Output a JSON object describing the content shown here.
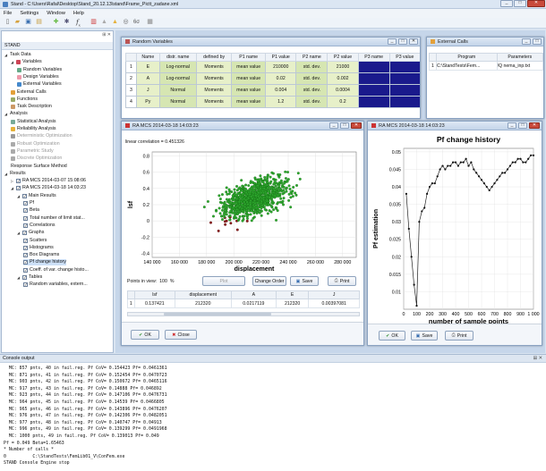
{
  "titlebar": {
    "title": "Stand - C:\\Users\\Rafal\\Desktop\\Stand_20.12.13\\stand\\Frame_Pictt_zadane.xml"
  },
  "menu": [
    "File",
    "Settings",
    "Window",
    "Help"
  ],
  "toolbar_icons": [
    "new-icon",
    "open-icon",
    "save-icon",
    "folder-icon",
    "random-variable-icon",
    "settings-icon",
    "function-icon",
    "chart-icon",
    "sensitivity-icon",
    "reliability-icon",
    "sigma-icon",
    "stop-icon"
  ],
  "tree": {
    "header": "STAND",
    "items": [
      {
        "label": "Task Data",
        "level": 0,
        "expand": "▲"
      },
      {
        "label": "Variables",
        "level": 1,
        "expand": "▲",
        "icon": "#c45"
      },
      {
        "label": "Random Variables",
        "level": 2,
        "icon": "#6a8"
      },
      {
        "label": "Design Variables",
        "level": 2,
        "icon": "#e9a"
      },
      {
        "label": "External Variables",
        "level": 2,
        "icon": "#48c"
      },
      {
        "label": "External Calls",
        "level": 1,
        "icon": "#e3a03a"
      },
      {
        "label": "Functions",
        "level": 1,
        "icon": "#9a6"
      },
      {
        "label": "Task Description",
        "level": 1,
        "icon": "#c96"
      },
      {
        "label": "Analysis",
        "level": 0,
        "expand": "▲"
      },
      {
        "label": "Statistical Analysis",
        "level": 1,
        "icon": "#7a9"
      },
      {
        "label": "Reliability Analysis",
        "level": 1,
        "icon": "#e6b13a"
      },
      {
        "label": "Deterministic Optimization",
        "level": 1,
        "icon": "#999",
        "grey": true
      },
      {
        "label": "Robust Optimization",
        "level": 1,
        "icon": "#aaa",
        "grey": true
      },
      {
        "label": "Parametric Study",
        "level": 1,
        "icon": "#aaa",
        "grey": true
      },
      {
        "label": "Discrete Optimization",
        "level": 1,
        "icon": "#aaa",
        "grey": true
      },
      {
        "label": "Response Surface Method",
        "level": 1
      },
      {
        "label": "Results",
        "level": 0,
        "expand": "▲"
      },
      {
        "label": "RA MCS 2014-03-07 15:08:06",
        "level": 1,
        "expand": "▷",
        "check": true
      },
      {
        "label": "RA MCS 2014-03-18 14:03:23",
        "level": 1,
        "expand": "▲",
        "check": true
      },
      {
        "label": "Main Results",
        "level": 2,
        "expand": "▲",
        "check": true
      },
      {
        "label": "Pf",
        "level": 3,
        "check": true
      },
      {
        "label": "Beta",
        "level": 3,
        "check": true
      },
      {
        "label": "Total number of limit stat...",
        "level": 3,
        "check": true
      },
      {
        "label": "Correlations",
        "level": 3,
        "check": true
      },
      {
        "label": "Graphs",
        "level": 2,
        "expand": "▲",
        "check": true
      },
      {
        "label": "Scatters",
        "level": 3,
        "check": true
      },
      {
        "label": "Histograms",
        "level": 3,
        "check": true
      },
      {
        "label": "Box Diagrams",
        "level": 3,
        "check": true
      },
      {
        "label": "Pf change history",
        "level": 3,
        "check": true,
        "selected": true
      },
      {
        "label": "Coeff. of var. change histo...",
        "level": 3,
        "check": true
      },
      {
        "label": "Tables",
        "level": 2,
        "expand": "▲",
        "check": true
      },
      {
        "label": "Random variables, extern...",
        "level": 3,
        "check": true
      }
    ]
  },
  "rv_window": {
    "title": "Random Variables",
    "headers": [
      "Name",
      "distr. name",
      "defined by",
      "P1 name",
      "P1 value",
      "P2 name",
      "P2 value",
      "P3 name",
      "P3 value"
    ],
    "rows": [
      [
        "1",
        "E",
        "Log-normal",
        "Moments",
        "mean value",
        "210000",
        "std. dev.",
        "21000"
      ],
      [
        "2",
        "A",
        "Log-normal",
        "Moments",
        "mean value",
        "0.02",
        "std. dev.",
        "0.002"
      ],
      [
        "3",
        "J",
        "Normal",
        "Moments",
        "mean value",
        "0.004",
        "std. dev.",
        "0.0004"
      ],
      [
        "4",
        "Py",
        "Normal",
        "Moments",
        "mean value",
        "1.2",
        "std. dev.",
        "0.2"
      ]
    ]
  },
  "ext_window": {
    "title": "External Calls",
    "headers": [
      "Program",
      "Parameters"
    ],
    "rows": [
      [
        "1",
        "C:\\StandTests\\Fem...",
        "/Q nema_inp.txt"
      ]
    ]
  },
  "scatter_window": {
    "title": "RA MCS 2014-03-18 14:03:23",
    "correlation": "linear correlation = 0.451326",
    "points_in_view_label": "Points in view:",
    "points_in_view": "100",
    "points_in_view_unit": "%",
    "buttons": {
      "plot": "Plot",
      "change_order": "Change Order",
      "save": "Save",
      "print": "Print",
      "ok": "OK",
      "close": "Close"
    },
    "table_headers": [
      "",
      "lsf",
      "displacement",
      "A",
      "E",
      "J"
    ],
    "table_row": [
      "1",
      "0.137421",
      "212320",
      "0.0217119",
      "212320",
      "0.00397081"
    ]
  },
  "pf_window": {
    "title": "RA MCS 2014-03-18 14:03:23",
    "buttons": {
      "ok": "OK",
      "save": "Save",
      "print": "Print"
    }
  },
  "console": {
    "title": "Console output",
    "lines": [
      "  MC: 857 pnts, 40 in fail.reg. Pf CoV= 0.154423 Pf= 0.0461361",
      "  MC: 871 pnts, 41 in fail.reg. Pf CoV= 0.152454 Pf= 0.0470723",
      "  MC: 903 pnts, 42 in fail.reg. Pf CoV= 0.150672 Pf= 0.0465116",
      "  MC: 917 pnts, 43 in fail.reg. Pf CoV= 0.14888 Pf= 0.046892",
      "  MC: 923 pnts, 44 in fail.reg. Pf CoV= 0.147106 Pf= 0.0476731",
      "  MC: 964 pnts, 45 in fail.reg. Pf CoV= 0.14539 Pf= 0.0466805",
      "  MC: 965 pnts, 46 in fail.reg. Pf CoV= 0.143896 Pf= 0.0476207",
      "  MC: 976 pnts, 47 in fail.reg. Pf CoV= 0.142306 Pf= 0.0482051",
      "  MC: 977 pnts, 48 in fail.reg. Pf CoV= 0.140747 Pf= 0.04913",
      "  MC: 996 pnts, 49 in fail.reg. Pf CoV= 0.139299 Pf= 0.0491968",
      "  MC: 1000 pnts, 49 in fail.reg. Pf CoV= 0.139013 Pf= 0.049",
      "Pf = 0.049 Beta=1.65463",
      "* Number of calls *",
      "0          C:\\StandTests\\FemLib01_V\\ConFem.exe",
      "STAND Console Engine stop"
    ]
  },
  "chart_data": [
    {
      "type": "scatter",
      "title": "",
      "xlabel": "displacement",
      "ylabel": "lsf",
      "xlim": [
        140000,
        290000
      ],
      "ylim": [
        -0.45,
        0.85
      ],
      "xticks": [
        "140 000",
        "160 000",
        "180 000",
        "200 000",
        "220 000",
        "240 000",
        "260 000",
        "280 000"
      ],
      "yticks": [
        "0.8",
        "0.6",
        "0.4",
        "0.2",
        "0",
        "-0.2",
        "-0.4"
      ],
      "series": [],
      "color_safe": "#2ea82e",
      "color_fail": "#8b1a1a"
    },
    {
      "type": "line",
      "title": "Pf change history",
      "xlabel": "number of sample points",
      "ylabel": "Pf estimation",
      "xlim": [
        0,
        1000
      ],
      "ylim": [
        0.005,
        0.051
      ],
      "xticks": [
        "0",
        "100",
        "200",
        "300",
        "400",
        "500",
        "600",
        "700",
        "800",
        "900",
        "1 000"
      ],
      "yticks": [
        "0.05",
        "0.045",
        "0.04",
        "0.035",
        "0.03",
        "0.025",
        "0.02",
        "0.015",
        "0.01"
      ],
      "x": [
        20,
        40,
        60,
        80,
        100,
        120,
        140,
        160,
        180,
        200,
        220,
        240,
        260,
        280,
        300,
        320,
        340,
        360,
        380,
        400,
        420,
        440,
        460,
        480,
        500,
        520,
        540,
        560,
        580,
        600,
        620,
        640,
        660,
        680,
        700,
        720,
        740,
        760,
        780,
        800,
        820,
        840,
        860,
        880,
        900,
        920,
        940,
        960,
        980,
        1000
      ],
      "y": [
        0.038,
        0.028,
        0.02,
        0.012,
        0.006,
        0.03,
        0.033,
        0.034,
        0.038,
        0.04,
        0.041,
        0.041,
        0.043,
        0.045,
        0.046,
        0.045,
        0.046,
        0.046,
        0.047,
        0.047,
        0.046,
        0.047,
        0.047,
        0.048,
        0.046,
        0.047,
        0.045,
        0.044,
        0.043,
        0.042,
        0.041,
        0.04,
        0.039,
        0.04,
        0.041,
        0.042,
        0.043,
        0.044,
        0.044,
        0.045,
        0.046,
        0.047,
        0.047,
        0.048,
        0.048,
        0.047,
        0.047,
        0.048,
        0.049,
        0.049
      ]
    }
  ]
}
